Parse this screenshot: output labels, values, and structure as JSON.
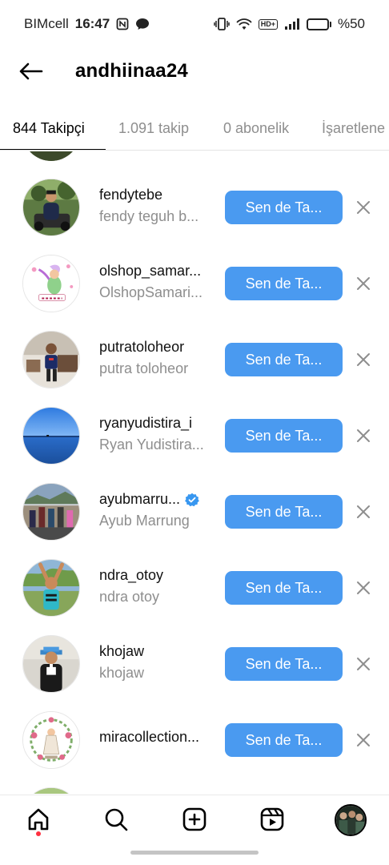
{
  "status_bar": {
    "carrier": "BIMcell",
    "time": "16:47",
    "hd_label": "HD+",
    "battery_percent_label": "%50",
    "battery_level": 0.5
  },
  "header": {
    "title": "andhiinaa24",
    "back_icon": "arrow-left-icon"
  },
  "tabs": [
    {
      "label": "844 Takipçi",
      "active": true
    },
    {
      "label": "1.091 takip",
      "active": false
    },
    {
      "label": "0 abonelik",
      "active": false
    },
    {
      "label": "İşaretlene",
      "active": false
    }
  ],
  "follow_button_label": "Sen de Ta...",
  "users": [
    {
      "username": "fendytebe",
      "fullname": "fendy teguh b...",
      "verified": false
    },
    {
      "username": "olshop_samar...",
      "fullname": "OlshopSamari...",
      "verified": false
    },
    {
      "username": "putratoloheor",
      "fullname": "putra toloheor",
      "verified": false
    },
    {
      "username": "ryanyudistira_i",
      "fullname": "Ryan Yudistira...",
      "verified": false
    },
    {
      "username": "ayubmarru...",
      "fullname": "Ayub Marrung",
      "verified": true
    },
    {
      "username": "ndra_otoy",
      "fullname": "ndra otoy",
      "verified": false
    },
    {
      "username": "khojaw",
      "fullname": "khojaw",
      "verified": false
    },
    {
      "username": "miracollection...",
      "fullname": "",
      "verified": false
    }
  ],
  "bottom_nav": [
    "home-icon",
    "search-icon",
    "create-icon",
    "reels-icon",
    "profile-avatar"
  ],
  "colors": {
    "accent": "#4a9af0",
    "verified": "#3897f0",
    "notification_dot": "#ff3040"
  }
}
